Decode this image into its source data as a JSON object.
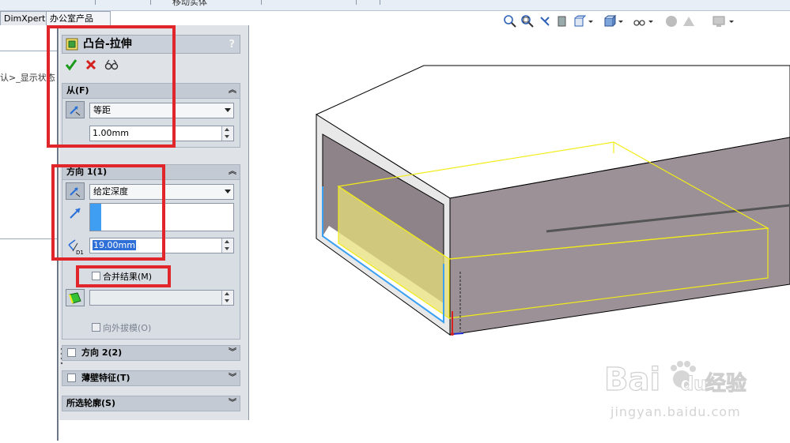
{
  "top_strip": {
    "text": "移动实体"
  },
  "tabs": [
    {
      "label": "DimXpert"
    },
    {
      "label": "办公室产品"
    }
  ],
  "left_panel": {
    "breadcrumb": "认>_显示状态"
  },
  "property_manager": {
    "title": "凸台-拉伸",
    "help": "?",
    "ok_icon": "checkmark-icon",
    "cancel_icon": "close-icon",
    "preview_icon": "glasses-icon",
    "from": {
      "header": "从(F)",
      "type": "等距",
      "offset": "1.00mm"
    },
    "direction1": {
      "header": "方向 1(1)",
      "end_condition": "给定深度",
      "depth": "19.00mm",
      "depth_icon_label": "D1"
    },
    "merge_result": {
      "label": "合并结果(M)",
      "checked": false
    },
    "draft_outward": {
      "label": "向外拔模(O)",
      "checked": false
    },
    "direction2": {
      "header": "方向 2(2)",
      "checked": false
    },
    "thin_feature": {
      "header": "薄壁特征(T)",
      "checked": false
    },
    "selected_contours": {
      "header": "所选轮廓(S)"
    }
  },
  "colors": {
    "highlight_red": "#e0252b",
    "preview_yellow": "#f2ec18",
    "edge_blue": "#3aa0f2",
    "body_gray": "#9b9196"
  },
  "watermark": {
    "logo_text": "Bai du 经验",
    "url": "jingyan.baidu.com"
  }
}
